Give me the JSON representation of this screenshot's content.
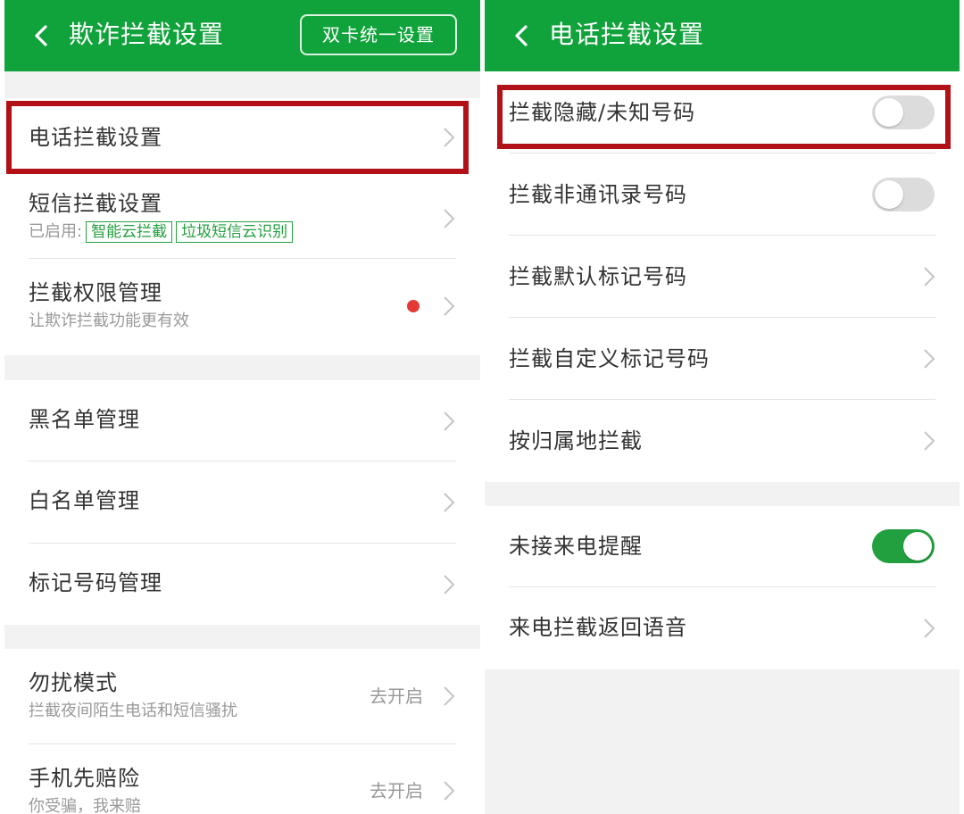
{
  "left": {
    "header": {
      "title": "欺诈拦截设置",
      "action_label": "双卡统一设置"
    },
    "items": [
      {
        "label": "电话拦截设置"
      },
      {
        "label": "短信拦截设置",
        "enabled_prefix": "已启用:",
        "tags": [
          "智能云拦截",
          "垃圾短信云识别"
        ]
      },
      {
        "label": "拦截权限管理",
        "sub": "让欺诈拦截功能更有效"
      },
      {
        "label": "黑名单管理"
      },
      {
        "label": "白名单管理"
      },
      {
        "label": "标记号码管理"
      },
      {
        "label": "勿扰模式",
        "sub": "拦截夜间陌生电话和短信骚扰",
        "action": "去开启"
      },
      {
        "label": "手机先赔险",
        "sub": "你受骗，我来赔",
        "action": "去开启"
      }
    ]
  },
  "right": {
    "header": {
      "title": "电话拦截设置"
    },
    "items": [
      {
        "label": "拦截隐藏/未知号码",
        "toggle": "off"
      },
      {
        "label": "拦截非通讯录号码",
        "toggle": "off"
      },
      {
        "label": "拦截默认标记号码"
      },
      {
        "label": "拦截自定义标记号码"
      },
      {
        "label": "按归属地拦截"
      },
      {
        "label": "未接来电提醒",
        "toggle": "on"
      },
      {
        "label": "来电拦截返回语音"
      }
    ]
  },
  "colors": {
    "header": "#11a33b",
    "accent": "#22a03f",
    "highlight": "#b21217",
    "badge": "#e53935"
  }
}
